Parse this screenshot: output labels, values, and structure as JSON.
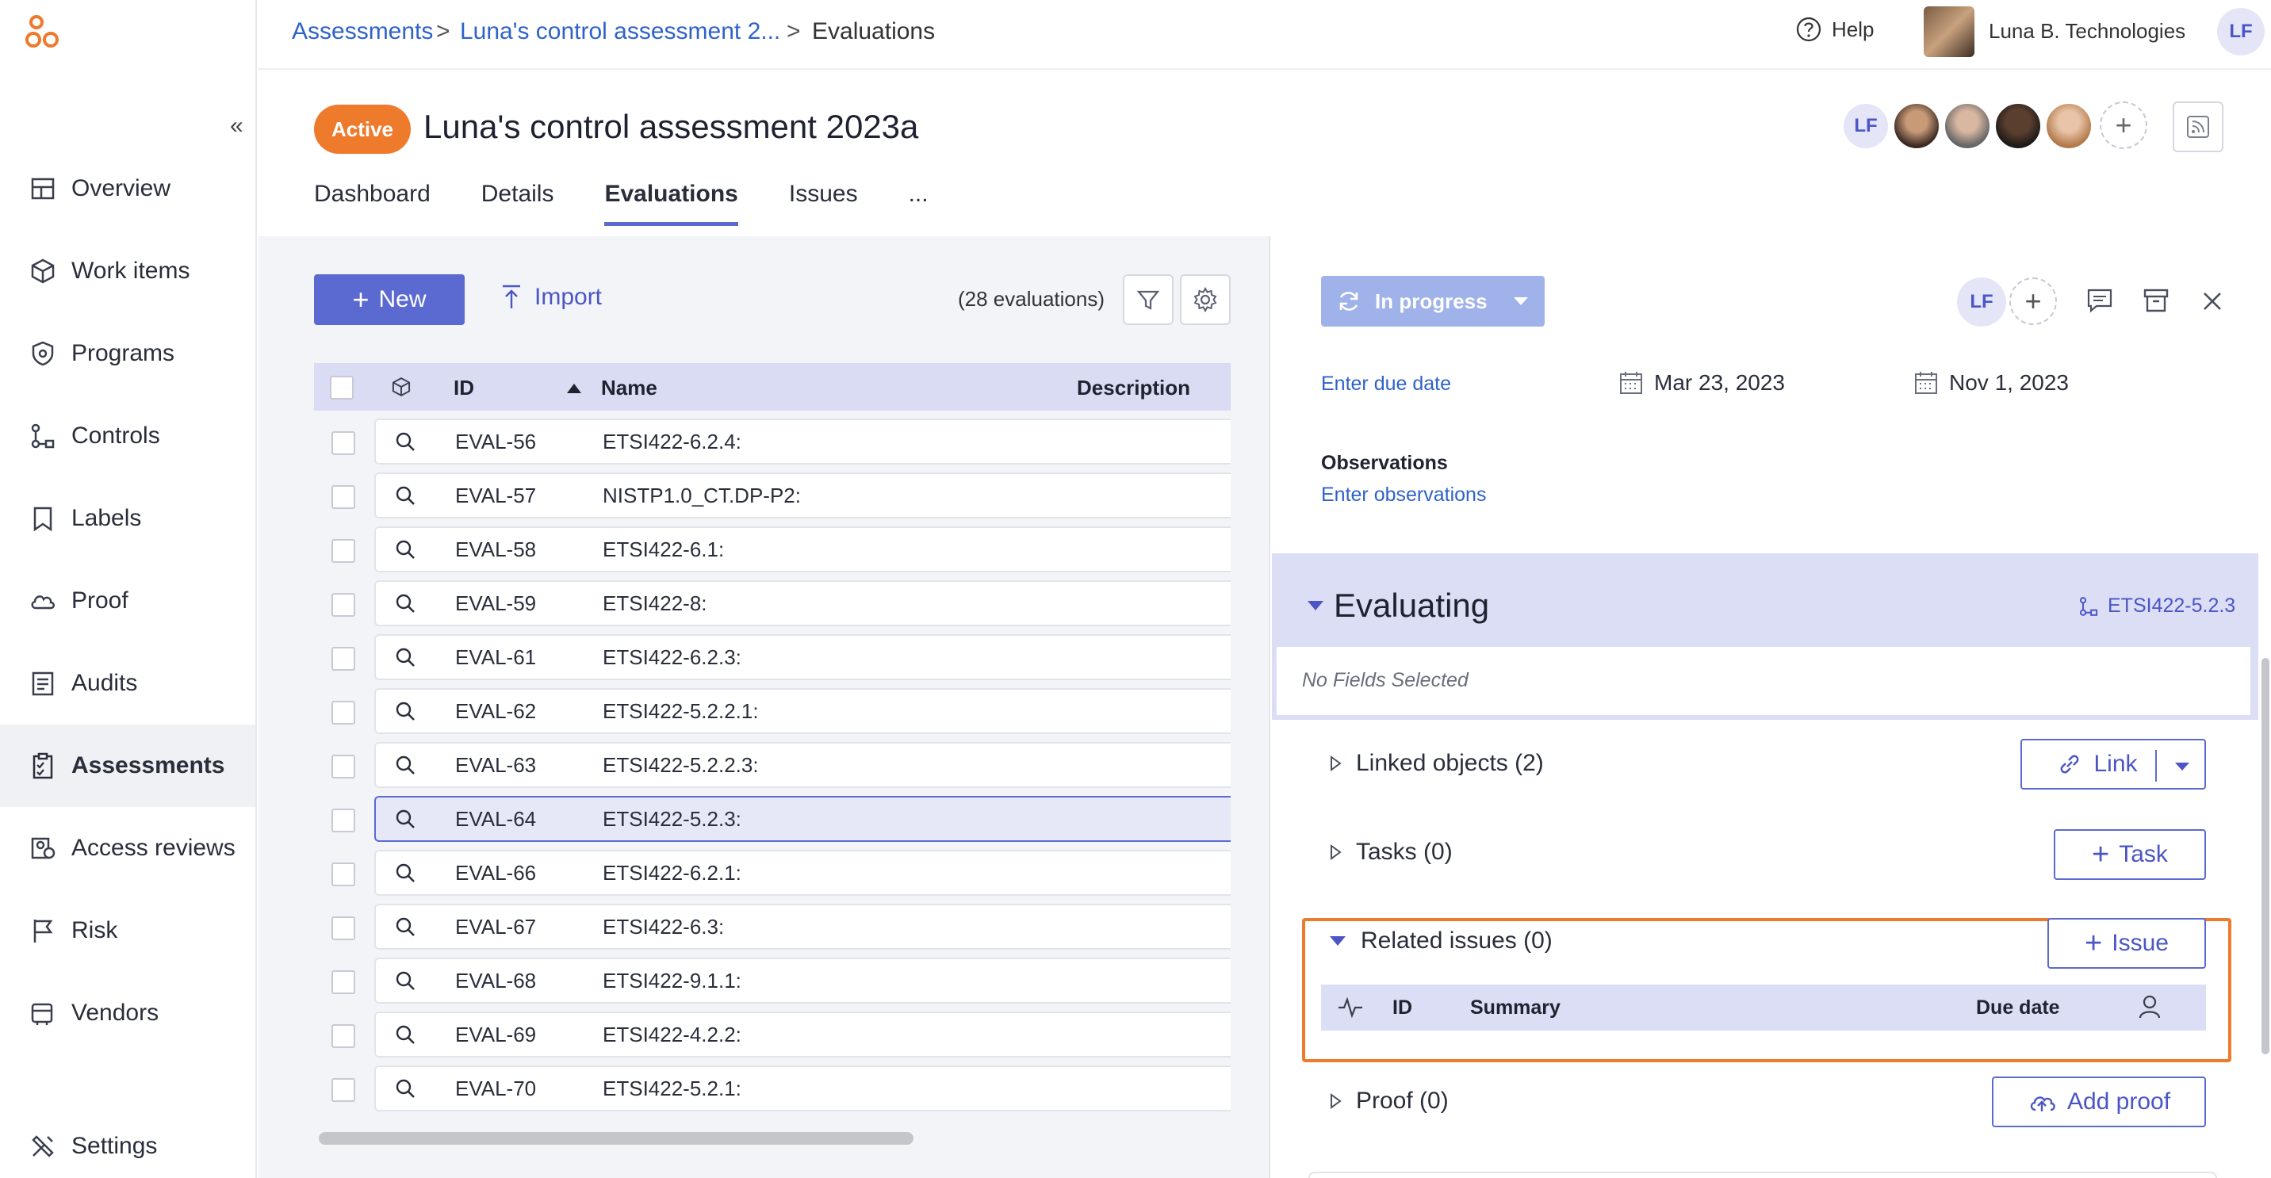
{
  "brand": {
    "accent": "#5b6ad0",
    "orange": "#ee7a2c",
    "link": "#2f62c9"
  },
  "sidebar": {
    "collapse_label": "«",
    "items": [
      {
        "label": "Overview",
        "icon": "layout-icon"
      },
      {
        "label": "Work items",
        "icon": "cube-icon"
      },
      {
        "label": "Programs",
        "icon": "shield-icon"
      },
      {
        "label": "Controls",
        "icon": "flow-icon"
      },
      {
        "label": "Labels",
        "icon": "bookmark-icon"
      },
      {
        "label": "Proof",
        "icon": "cloud-icon"
      },
      {
        "label": "Audits",
        "icon": "report-icon"
      },
      {
        "label": "Assessments",
        "icon": "clipboard-icon",
        "active": true
      },
      {
        "label": "Access reviews",
        "icon": "access-icon"
      },
      {
        "label": "Risk",
        "icon": "flag-icon"
      },
      {
        "label": "Vendors",
        "icon": "vendor-icon"
      }
    ],
    "settings_label": "Settings"
  },
  "header": {
    "breadcrumb": [
      "Assessments",
      "Luna's control assessment 2...",
      "Evaluations"
    ],
    "separator": ">",
    "help_label": "Help",
    "org_name": "Luna B. Technologies",
    "user_initials": "LF"
  },
  "page": {
    "status_badge": "Active",
    "title": "Luna's control assessment 2023a",
    "member_initials": "LF",
    "tabs": [
      "Dashboard",
      "Details",
      "Evaluations",
      "Issues",
      "..."
    ],
    "active_tab": "Evaluations"
  },
  "list": {
    "new_label": "New",
    "import_label": "Import",
    "count_text": "(28 evaluations)",
    "columns": {
      "id": "ID",
      "name": "Name",
      "description": "Description"
    },
    "rows": [
      {
        "id": "EVAL-56",
        "name": "ETSI422-6.2.4:"
      },
      {
        "id": "EVAL-57",
        "name": "NISTP1.0_CT.DP-P2:"
      },
      {
        "id": "EVAL-58",
        "name": "ETSI422-6.1:"
      },
      {
        "id": "EVAL-59",
        "name": "ETSI422-8:"
      },
      {
        "id": "EVAL-61",
        "name": "ETSI422-6.2.3:"
      },
      {
        "id": "EVAL-62",
        "name": "ETSI422-5.2.2.1:"
      },
      {
        "id": "EVAL-63",
        "name": "ETSI422-5.2.2.3:"
      },
      {
        "id": "EVAL-64",
        "name": "ETSI422-5.2.3:",
        "selected": true
      },
      {
        "id": "EVAL-66",
        "name": "ETSI422-6.2.1:"
      },
      {
        "id": "EVAL-67",
        "name": "ETSI422-6.3:"
      },
      {
        "id": "EVAL-68",
        "name": "ETSI422-9.1.1:"
      },
      {
        "id": "EVAL-69",
        "name": "ETSI422-4.2.2:"
      },
      {
        "id": "EVAL-70",
        "name": "ETSI422-5.2.1:"
      }
    ]
  },
  "detail": {
    "status_label": "In progress",
    "assignee_initials": "LF",
    "due_date_placeholder": "Enter due date",
    "start_date": "Mar 23, 2023",
    "end_date": "Nov 1, 2023",
    "observations_label": "Observations",
    "observations_placeholder": "Enter observations",
    "evaluating_title": "Evaluating",
    "evaluating_ref": "ETSI422-5.2.3",
    "no_fields": "No Fields Selected",
    "linked_objects": "Linked objects (2)",
    "link_label": "Link",
    "tasks": "Tasks (0)",
    "task_label": "Task",
    "related_issues": "Related issues (0)",
    "issue_label": "Issue",
    "issue_columns": {
      "id": "ID",
      "summary": "Summary",
      "due_date": "Due date"
    },
    "proof": "Proof (0)",
    "add_proof_label": "Add proof"
  }
}
